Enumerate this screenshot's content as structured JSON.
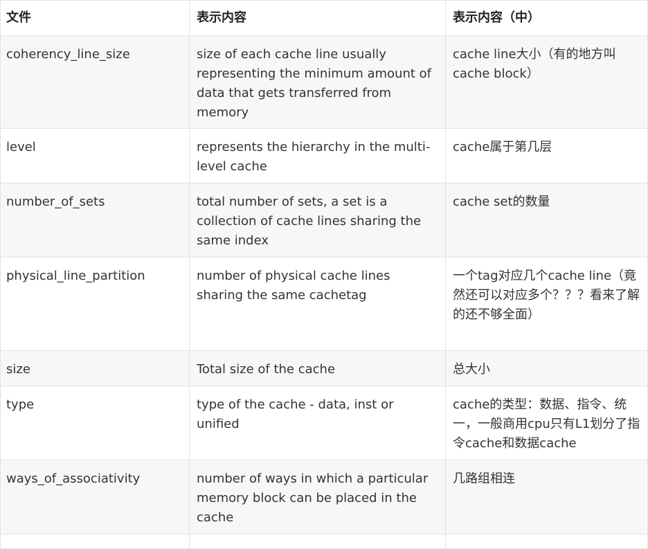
{
  "table": {
    "headers": [
      "文件",
      "表示内容",
      "表示内容（中）"
    ],
    "rows": [
      {
        "file": "coherency_line_size",
        "desc": "size of each cache line usually representing the minimum amount of data that gets transferred from memory",
        "desc_zh": "cache line大小（有的地方叫cache block）"
      },
      {
        "file": "level",
        "desc": "represents the hierarchy in the multi-level cache",
        "desc_zh": "cache属于第几层"
      },
      {
        "file": "number_of_sets",
        "desc": "total number of sets, a set is a collection of cache lines sharing the same index",
        "desc_zh": "cache set的数量"
      },
      {
        "file": "physical_line_partition",
        "desc": "number of physical cache lines sharing the same cachetag",
        "desc_zh": "一个tag对应几个cache line（竟然还可以对应多个？？？看来了解的还不够全面）"
      },
      {
        "file": "size",
        "desc": "Total size of the cache",
        "desc_zh": "总大小"
      },
      {
        "file": "type",
        "desc": "type of the cache - data, inst or unified",
        "desc_zh": "cache的类型：数据、指令、统一，一般商用cpu只有L1划分了指令cache和数据cache"
      },
      {
        "file": "ways_of_associativity",
        "desc": "number of ways in which a particular memory block can be placed in the cache",
        "desc_zh": "几路组相连"
      }
    ]
  }
}
